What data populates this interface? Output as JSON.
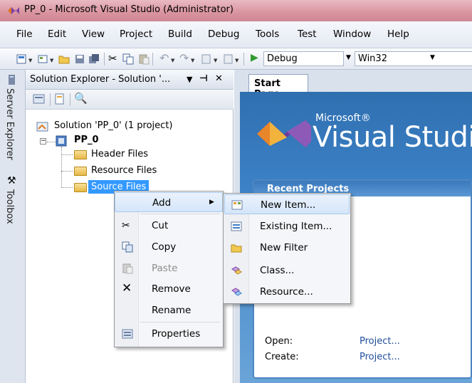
{
  "window": {
    "title": "PP_0 - Microsoft Visual Studio (Administrator)"
  },
  "menu": [
    "File",
    "Edit",
    "View",
    "Project",
    "Build",
    "Debug",
    "Tools",
    "Test",
    "Window",
    "Help"
  ],
  "toolbar": {
    "config": "Debug",
    "platform": "Win32"
  },
  "side_tabs": {
    "server_explorer": "Server Explorer",
    "toolbox": "Toolbox"
  },
  "solution_explorer": {
    "title": "Solution Explorer - Solution '...",
    "pin": "↓ ɨ",
    "close": "✕",
    "solution": "Solution 'PP_0' (1 project)",
    "project": "PP_0",
    "folders": [
      "Header Files",
      "Resource Files",
      "Source Files"
    ]
  },
  "start_page": {
    "tab": "Start Page",
    "microsoft": "Microsoft®",
    "visual_studio": "Visual Studio",
    "recent_projects": "Recent Projects",
    "open_label": "Open:",
    "create_label": "Create:",
    "open_link": "Project...",
    "create_link": "Project..."
  },
  "context_menu": {
    "items": [
      "Add",
      "Cut",
      "Copy",
      "Paste",
      "Remove",
      "Rename",
      "Properties"
    ]
  },
  "submenu": {
    "items": [
      "New Item...",
      "Existing Item...",
      "New Filter",
      "Class...",
      "Resource..."
    ]
  },
  "colors": {
    "titlebar": "#d9949f",
    "startpage": "#3b80c4",
    "highlight": "#d5e6fa"
  }
}
